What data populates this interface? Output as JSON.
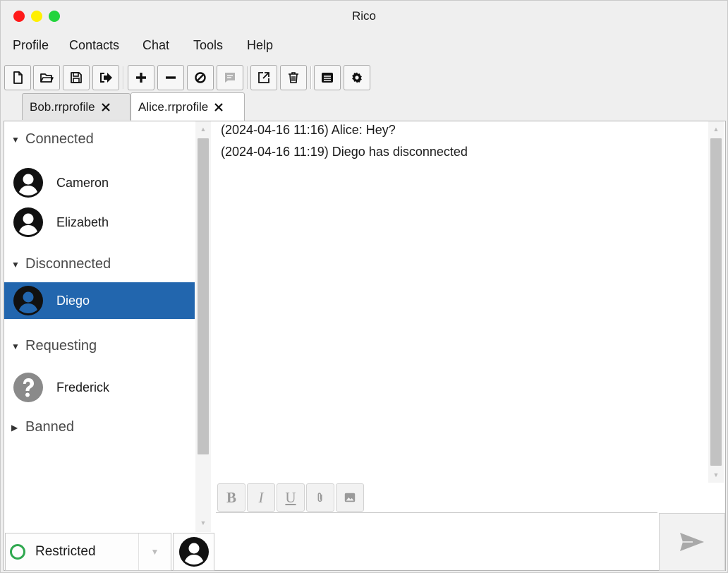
{
  "window": {
    "title": "Rico"
  },
  "menu": [
    "Profile",
    "Contacts",
    "Chat",
    "Tools",
    "Help"
  ],
  "toolbar": {
    "buttons": [
      {
        "icon": "new-file-icon"
      },
      {
        "icon": "open-folder-icon"
      },
      {
        "icon": "save-icon"
      },
      {
        "icon": "logout-icon"
      },
      {
        "icon": "plus-icon"
      },
      {
        "icon": "minus-icon"
      },
      {
        "icon": "block-icon"
      },
      {
        "icon": "message-icon",
        "disabled": true
      },
      {
        "icon": "external-link-icon"
      },
      {
        "icon": "trash-icon"
      },
      {
        "icon": "list-icon"
      },
      {
        "icon": "gear-icon"
      }
    ]
  },
  "tabs": [
    {
      "label": "Bob.rrprofile",
      "active": false
    },
    {
      "label": "Alice.rrprofile",
      "active": true
    }
  ],
  "contacts": {
    "groups": [
      {
        "label": "Connected",
        "expanded": true,
        "items": [
          "Cameron",
          "Elizabeth"
        ]
      },
      {
        "label": "Disconnected",
        "expanded": true,
        "items": [
          "Diego"
        ],
        "selected": "Diego"
      },
      {
        "label": "Requesting",
        "expanded": true,
        "items": [
          "Frederick"
        ]
      },
      {
        "label": "Banned",
        "expanded": false,
        "items": []
      }
    ]
  },
  "status": {
    "label": "Restricted",
    "color": "#2fa84f"
  },
  "chat": {
    "messages": [
      "(2024-04-16 11:16) Alice: Hey?",
      "(2024-04-16 11:19) Diego has disconnected"
    ]
  },
  "format": {
    "bold": "B",
    "italic": "I",
    "underline": "U",
    "attach_icon": "paperclip-icon",
    "image_icon": "image-icon"
  },
  "compose": {
    "value": "",
    "send_icon": "send-icon"
  },
  "colors": {
    "selection": "#2266ae",
    "status_ring": "#2fa84f"
  }
}
